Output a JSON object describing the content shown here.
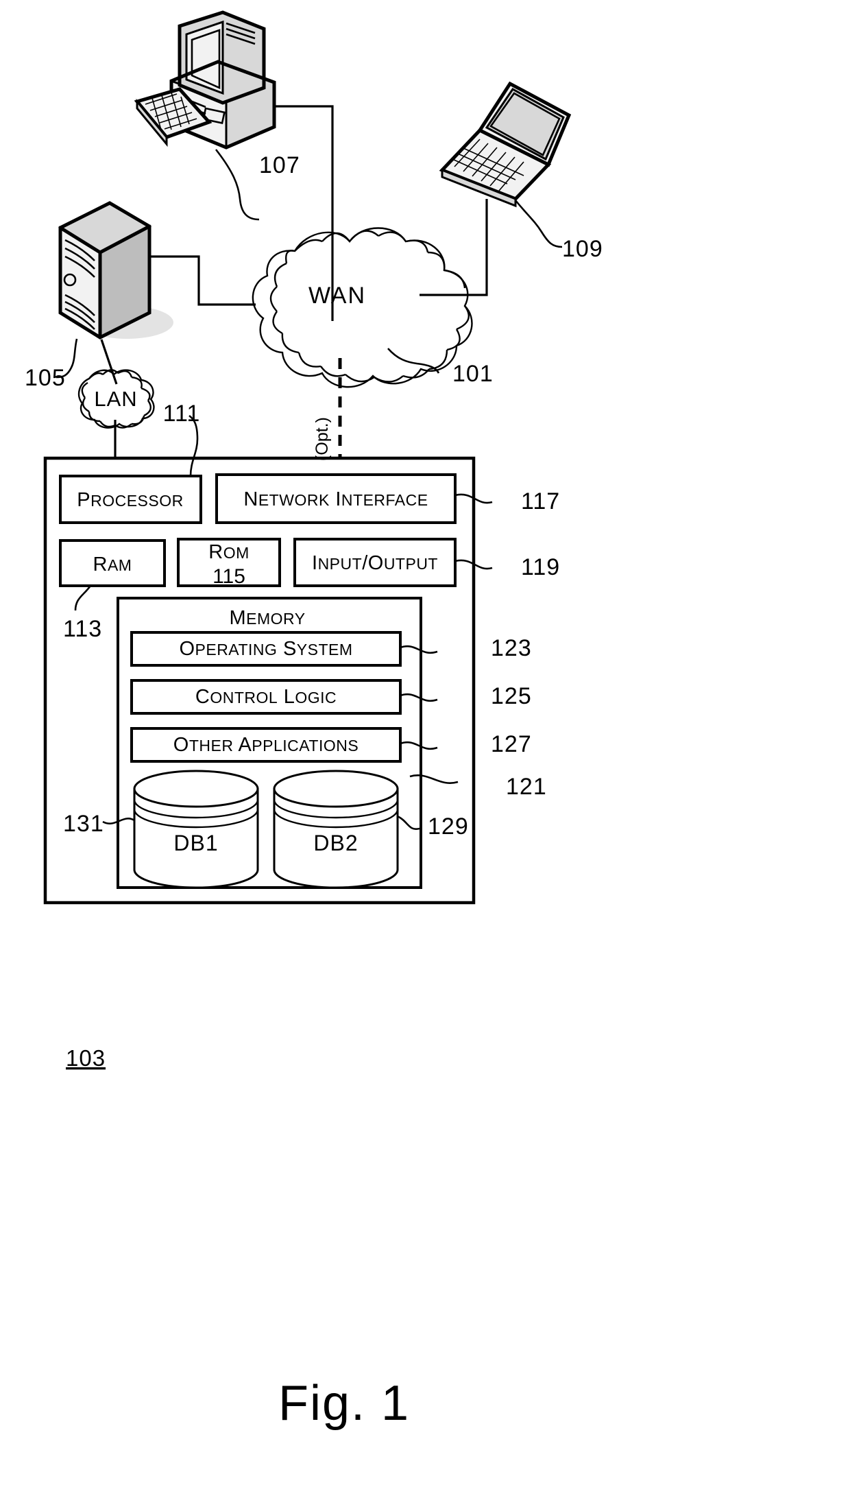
{
  "figure": {
    "caption": "Fig. 1",
    "title": "Network computing environment block diagram"
  },
  "networks": {
    "wan": {
      "label": "WAN",
      "ref": "101"
    },
    "lan": {
      "label": "LAN",
      "ref": null
    },
    "optional_link": {
      "label": "(Opt.)"
    }
  },
  "devices": [
    {
      "name": "desktop-workstation",
      "ref": "107",
      "icon": "desktop-computer-icon"
    },
    {
      "name": "laptop",
      "ref": "109",
      "icon": "laptop-icon"
    },
    {
      "name": "server-tower",
      "ref": "105",
      "icon": "server-tower-icon"
    }
  ],
  "computing_device": {
    "ref": "103",
    "hardware_row_1": [
      {
        "label": "Processor",
        "ref": "111"
      },
      {
        "label": "Network Interface",
        "ref": "117"
      }
    ],
    "hardware_row_2": [
      {
        "label": "RAM",
        "ref": "113"
      },
      {
        "label": "ROM",
        "ref": "115",
        "ref_inside": true
      },
      {
        "label": "Input/Output",
        "ref": "119"
      }
    ],
    "memory": {
      "label": "Memory",
      "ref": "121",
      "modules": [
        {
          "label": "Operating System",
          "ref": "123"
        },
        {
          "label": "Control Logic",
          "ref": "125"
        },
        {
          "label": "Other Applications",
          "ref": "127"
        }
      ],
      "databases": [
        {
          "label": "DB1",
          "ref": "131"
        },
        {
          "label": "DB2",
          "ref": "129"
        }
      ]
    }
  },
  "reference_numerals": {
    "n101": "101",
    "n103": "103",
    "n105": "105",
    "n107": "107",
    "n109": "109",
    "n111": "111",
    "n113": "113",
    "n115": "115",
    "n117": "117",
    "n119": "119",
    "n121": "121",
    "n123": "123",
    "n125": "125",
    "n127": "127",
    "n129": "129",
    "n131": "131"
  },
  "colors": {
    "ink": "#000000",
    "paper": "#ffffff",
    "shade_light": "#f2f2f2",
    "shade_mid": "#d8d8d8",
    "shade_dark": "#bdbdbd"
  }
}
